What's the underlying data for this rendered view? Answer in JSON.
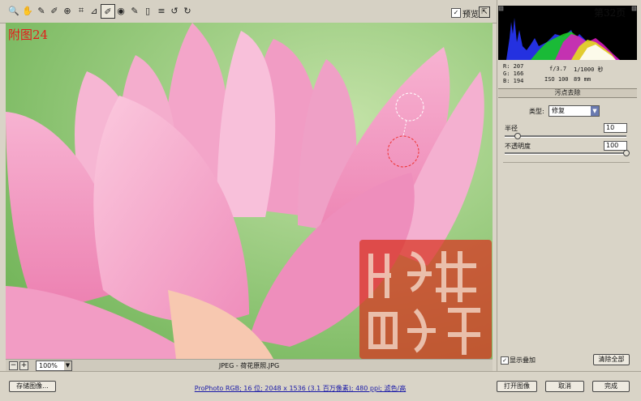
{
  "figure_label": "附图24",
  "toolbar": {
    "tools": [
      {
        "icon": "zoom-icon",
        "glyph": "🔍"
      },
      {
        "icon": "hand-icon",
        "glyph": "✋"
      },
      {
        "icon": "white-balance-icon",
        "glyph": "✎"
      },
      {
        "icon": "color-sampler-icon",
        "glyph": "✐"
      },
      {
        "icon": "target-adjust-icon",
        "glyph": "⊕"
      },
      {
        "icon": "crop-icon",
        "glyph": "⌗"
      },
      {
        "icon": "straighten-icon",
        "glyph": "⊿"
      },
      {
        "icon": "spot-removal-icon",
        "glyph": "✐"
      },
      {
        "icon": "red-eye-icon",
        "glyph": "◉"
      },
      {
        "icon": "adjustment-brush-icon",
        "glyph": "✎"
      },
      {
        "icon": "graduated-filter-icon",
        "glyph": "▯"
      },
      {
        "icon": "preferences-icon",
        "glyph": "≡"
      },
      {
        "icon": "rotate-ccw-icon",
        "glyph": "↺"
      },
      {
        "icon": "rotate-cw-icon",
        "glyph": "↻"
      }
    ],
    "selected_tool": 7,
    "preview_label": "预览",
    "preview_checked": "✓",
    "fullscreen_glyph": "⇱"
  },
  "status": {
    "zoom": "100%",
    "zoom_arrow": "▼",
    "minus": "−",
    "plus": "+",
    "filename": "JPEG - 荷花原照.JPG"
  },
  "panel": {
    "page_number": "第32页",
    "rgb": {
      "r": "R: 207",
      "g": "G: 166",
      "b": "B: 194"
    },
    "exif": {
      "aperture": "f/3.7",
      "shutter": "1/1000 秒",
      "iso": "ISO 100",
      "focal": "89 mm"
    },
    "section_title": "污点去除",
    "type_label": "类型:",
    "type_value": "修复",
    "type_arrow": "▼",
    "radius_label": "半径",
    "radius_value": "10",
    "opacity_label": "不透明度",
    "opacity_value": "100",
    "radius_fraction": 0.1,
    "opacity_fraction": 1.0,
    "show_overlay_label": "显示叠加",
    "show_overlay_checked": "✓",
    "clear_all_label": "清除全部"
  },
  "bottom": {
    "save_label": "存储图像...",
    "info_link": "ProPhoto RGB; 16 位; 2048 x 1536 (3.1 百万像素); 480 ppi; 滤色/高",
    "open_label": "打开图像",
    "cancel_label": "取消",
    "done_label": "完成"
  },
  "colors": {
    "panel_bg": "#d9d4c7",
    "petal_pink": "#f29ac2",
    "leaf_green": "#8dc872",
    "label_red": "#e31b1b",
    "seal_red": "#d8321e"
  }
}
